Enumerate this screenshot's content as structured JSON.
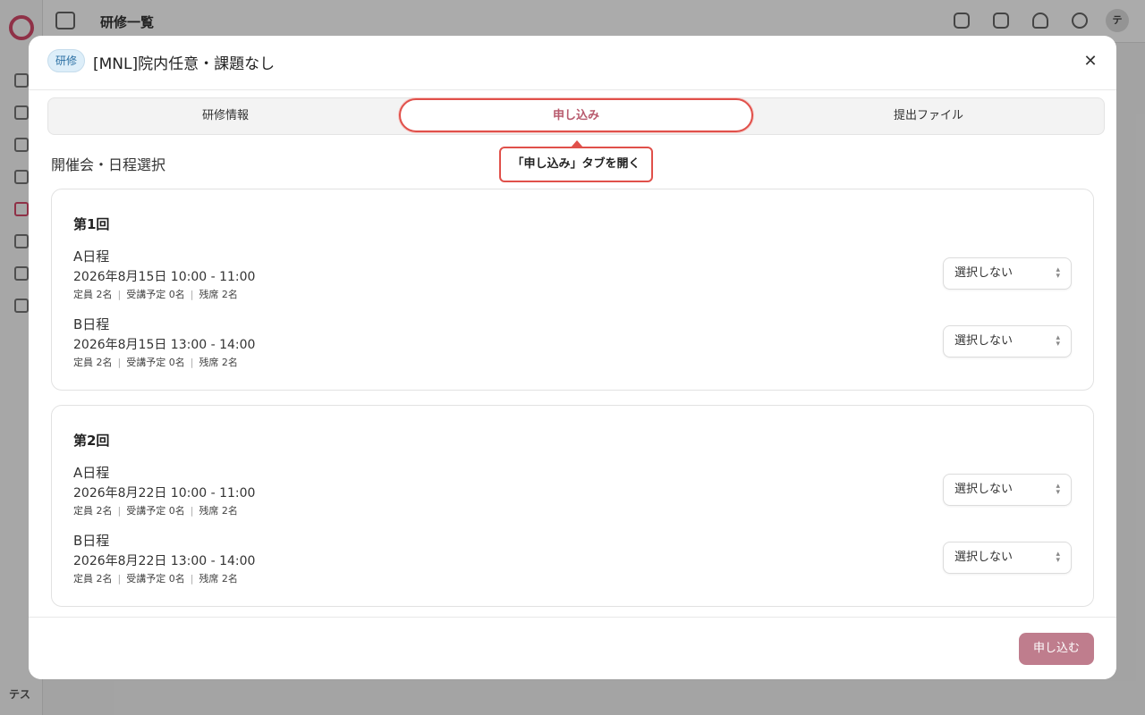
{
  "background": {
    "page_title": "研修一覧",
    "sidebar_footer": "テス"
  },
  "modal": {
    "badge": "研修",
    "title": "[MNL]院内任意・課題なし",
    "tabs": [
      {
        "label": "研修情報"
      },
      {
        "label": "申し込み"
      },
      {
        "label": "提出ファイル"
      }
    ],
    "callout": "「申し込み」タブを開く",
    "section_title": "開催会・日程選択",
    "sessions": [
      {
        "name": "第1回",
        "slots": [
          {
            "name": "A日程",
            "datetime": "2026年8月15日 10:00 - 11:00",
            "capacity": "定員 2名",
            "planned": "受講予定 0名",
            "remaining": "残席 2名",
            "select_value": "選択しない"
          },
          {
            "name": "B日程",
            "datetime": "2026年8月15日 13:00 - 14:00",
            "capacity": "定員 2名",
            "planned": "受講予定 0名",
            "remaining": "残席 2名",
            "select_value": "選択しない"
          }
        ]
      },
      {
        "name": "第2回",
        "slots": [
          {
            "name": "A日程",
            "datetime": "2026年8月22日 10:00 - 11:00",
            "capacity": "定員 2名",
            "planned": "受講予定 0名",
            "remaining": "残席 2名",
            "select_value": "選択しない"
          },
          {
            "name": "B日程",
            "datetime": "2026年8月22日 13:00 - 14:00",
            "capacity": "定員 2名",
            "planned": "受講予定 0名",
            "remaining": "残席 2名",
            "select_value": "選択しない"
          }
        ]
      }
    ],
    "submit_label": "申し込む"
  },
  "colors": {
    "accent": "#bf7d8d",
    "highlight": "#e0504a",
    "badge_bg": "#ddeef9"
  }
}
